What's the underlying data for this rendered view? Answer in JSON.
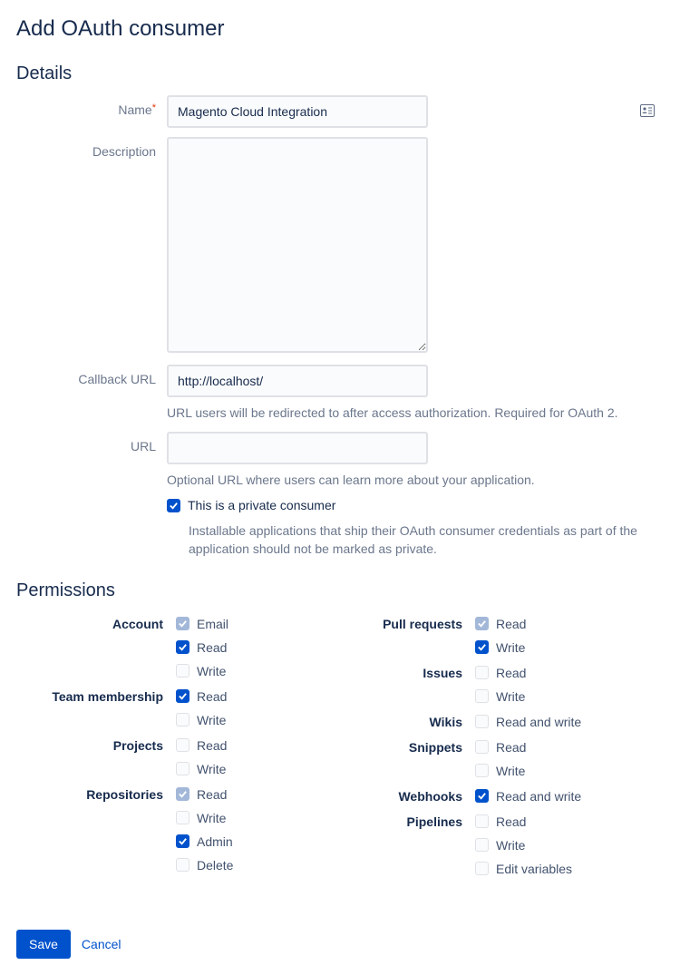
{
  "title": "Add OAuth consumer",
  "sections": {
    "details": "Details",
    "permissions": "Permissions"
  },
  "fields": {
    "name_label": "Name",
    "name_value": "Magento Cloud Integration",
    "desc_label": "Description",
    "desc_value": "",
    "callback_label": "Callback URL",
    "callback_value": "http://localhost/",
    "callback_help": "URL users will be redirected to after access authorization. Required for OAuth 2.",
    "url_label": "URL",
    "url_value": "",
    "url_help": "Optional URL where users can learn more about your application.",
    "private_label": "This is a private consumer",
    "private_help": "Installable applications that ship their OAuth consumer credentials as part of the application should not be marked as private."
  },
  "permissions": {
    "left": [
      {
        "label": "Account",
        "opts": [
          {
            "label": "Email",
            "checked": true,
            "disabled": true
          },
          {
            "label": "Read",
            "checked": true,
            "disabled": false
          },
          {
            "label": "Write",
            "checked": false,
            "disabled": false
          }
        ]
      },
      {
        "label": "Team membership",
        "opts": [
          {
            "label": "Read",
            "checked": true,
            "disabled": false
          },
          {
            "label": "Write",
            "checked": false,
            "disabled": false
          }
        ]
      },
      {
        "label": "Projects",
        "opts": [
          {
            "label": "Read",
            "checked": false,
            "disabled": false
          },
          {
            "label": "Write",
            "checked": false,
            "disabled": false
          }
        ]
      },
      {
        "label": "Repositories",
        "opts": [
          {
            "label": "Read",
            "checked": true,
            "disabled": true
          },
          {
            "label": "Write",
            "checked": false,
            "disabled": false
          },
          {
            "label": "Admin",
            "checked": true,
            "disabled": false
          },
          {
            "label": "Delete",
            "checked": false,
            "disabled": false
          }
        ]
      }
    ],
    "right": [
      {
        "label": "Pull requests",
        "opts": [
          {
            "label": "Read",
            "checked": true,
            "disabled": true
          },
          {
            "label": "Write",
            "checked": true,
            "disabled": false
          }
        ]
      },
      {
        "label": "Issues",
        "opts": [
          {
            "label": "Read",
            "checked": false,
            "disabled": false
          },
          {
            "label": "Write",
            "checked": false,
            "disabled": false
          }
        ]
      },
      {
        "label": "Wikis",
        "opts": [
          {
            "label": "Read and write",
            "checked": false,
            "disabled": false
          }
        ]
      },
      {
        "label": "Snippets",
        "opts": [
          {
            "label": "Read",
            "checked": false,
            "disabled": false
          },
          {
            "label": "Write",
            "checked": false,
            "disabled": false
          }
        ]
      },
      {
        "label": "Webhooks",
        "opts": [
          {
            "label": "Read and write",
            "checked": true,
            "disabled": false
          }
        ]
      },
      {
        "label": "Pipelines",
        "opts": [
          {
            "label": "Read",
            "checked": false,
            "disabled": false
          },
          {
            "label": "Write",
            "checked": false,
            "disabled": false
          },
          {
            "label": "Edit variables",
            "checked": false,
            "disabled": false
          }
        ]
      }
    ]
  },
  "actions": {
    "save": "Save",
    "cancel": "Cancel"
  }
}
